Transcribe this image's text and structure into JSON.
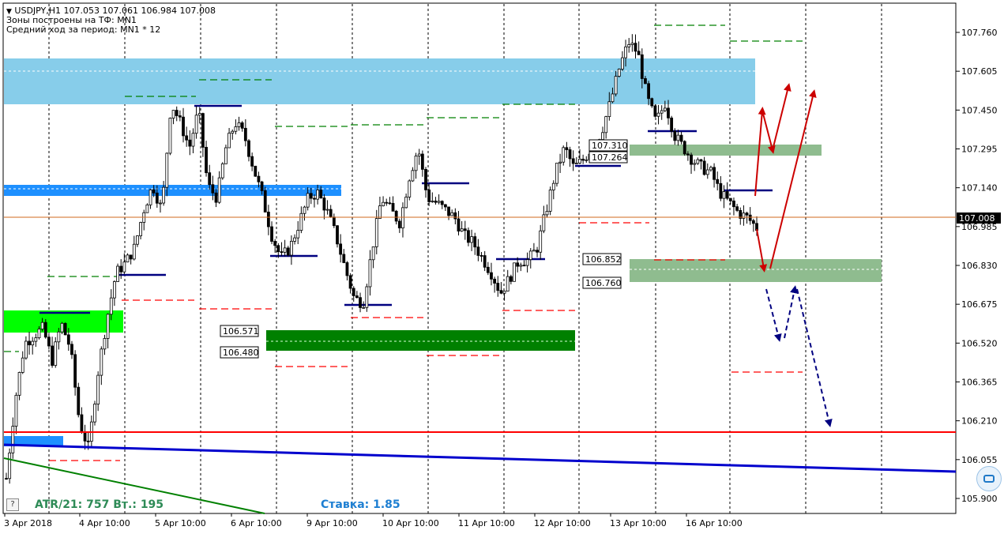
{
  "header": {
    "symbol_line": "USDJPY,H1  107.053 107.061 106.984 107.008",
    "zones_line": "Зоны построены на ТФ: MN1",
    "avg_line": "Средний ход за период: MN1 * 12"
  },
  "stats": {
    "atr": "ATR/21: 757  Вт.: 195",
    "rate": "Ставка: 1.85",
    "help": "?"
  },
  "colors": {
    "bg": "#ffffff",
    "candles": "#000000",
    "grid": "#000000",
    "zone_lightblue": "#87cdea",
    "zone_blue": "#1e90ff",
    "zone_green_bright": "#00ff00",
    "zone_green_dark": "#008000",
    "zone_green_light": "#8fbc8f",
    "support_red": "#ff0000",
    "trend_blue": "#0000cd",
    "trend_green": "#008000",
    "arrow_red": "#cc0000",
    "arrow_navy": "#000080",
    "current_price_line": "#d2691e",
    "stats_green": "#2e8b57",
    "stats_blue": "#1e7fd2"
  },
  "chart_data": {
    "type": "candlestick",
    "symbol": "USDJPY",
    "timeframe": "H1",
    "last_price": "107.008",
    "y_ticks": [
      "107.760",
      "107.605",
      "107.450",
      "107.295",
      "107.140",
      "106.985",
      "106.830",
      "106.675",
      "106.520",
      "106.365",
      "106.210",
      "106.055",
      "105.900"
    ],
    "x_ticks": [
      "3 Apr 2018",
      "4 Apr 10:00",
      "5 Apr 10:00",
      "6 Apr 10:00",
      "9 Apr 10:00",
      "10 Apr 10:00",
      "11 Apr 10:00",
      "12 Apr 10:00",
      "13 Apr 10:00",
      "16 Apr 10:00"
    ],
    "ylim": [
      105.85,
      107.81
    ],
    "close_path": [
      105.98,
      106.3,
      106.52,
      106.55,
      106.58,
      106.45,
      106.6,
      106.5,
      106.2,
      106.1,
      106.4,
      106.62,
      106.8,
      106.84,
      106.9,
      107.05,
      107.15,
      107.05,
      107.48,
      107.4,
      107.3,
      107.45,
      107.15,
      107.1,
      107.3,
      107.4,
      107.35,
      107.22,
      107.1,
      106.95,
      106.86,
      106.9,
      107.0,
      107.1,
      107.12,
      107.05,
      106.95,
      106.82,
      106.7,
      106.68,
      106.9,
      107.1,
      107.05,
      107.0,
      107.18,
      107.3,
      107.1,
      107.08,
      107.05,
      107.02,
      106.95,
      106.92,
      106.86,
      106.8,
      106.72,
      106.78,
      106.85,
      106.85,
      106.9,
      107.05,
      107.2,
      107.3,
      107.22,
      107.25,
      107.3,
      107.36,
      107.48,
      107.62,
      107.72,
      107.68,
      107.5,
      107.4,
      107.48,
      107.35,
      107.3,
      107.25,
      107.22,
      107.2,
      107.12,
      107.08,
      107.04,
      107.02,
      106.98
    ],
    "value_labels": [
      "107.310",
      "107.264",
      "106.852",
      "106.760",
      "106.571",
      "106.480"
    ],
    "current_price_label": "107.008"
  }
}
